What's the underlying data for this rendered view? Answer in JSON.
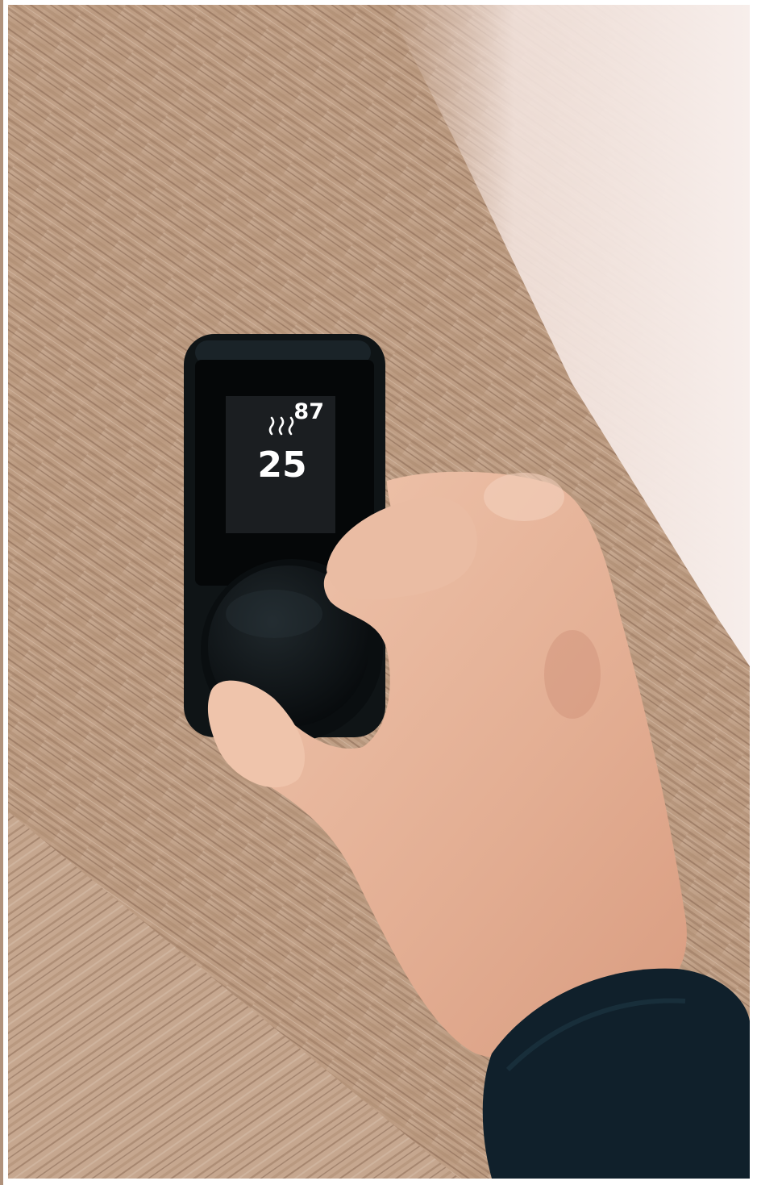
{
  "scene": {
    "description_free": true,
    "colors": {
      "wood_light": "#c8ab93",
      "wood_dark": "#8a6a55",
      "wall": "#f3e6e1",
      "device_body": "#0f1416",
      "screen": "#1b1e21",
      "skin": "#e6b59a",
      "sleeve": "#10202b"
    }
  },
  "device": {
    "screen": {
      "top_value": "87",
      "heat_icon": "heat-waves-icon",
      "main_value": "25"
    }
  }
}
